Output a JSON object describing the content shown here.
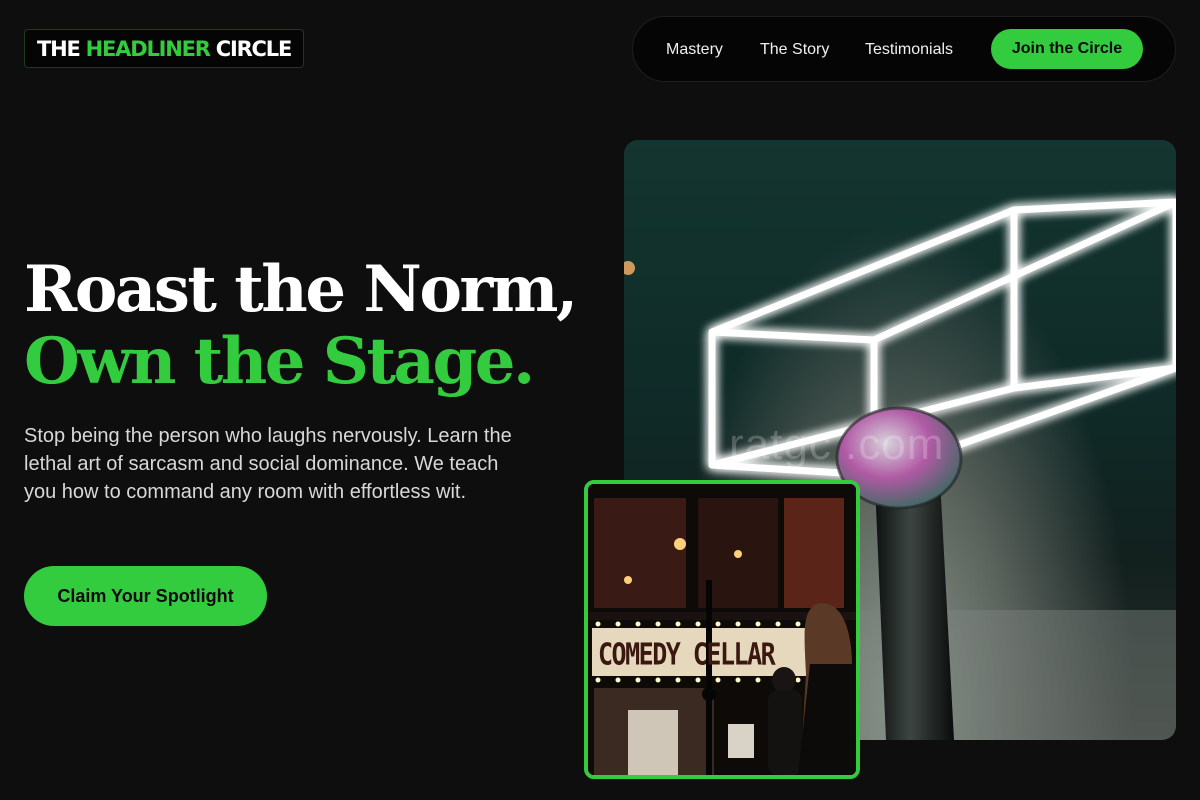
{
  "brand": {
    "logo_part1": "THE",
    "logo_part2": "HEADLINER",
    "logo_part3": "CIRCLE",
    "accent_color": "#34cc3f",
    "background_color": "#0e0e0e"
  },
  "nav": {
    "links": [
      {
        "label": "Mastery"
      },
      {
        "label": "The Story"
      },
      {
        "label": "Testimonials"
      }
    ],
    "cta_label": "Join the Circle"
  },
  "hero": {
    "headline_line1": "Roast the Norm,",
    "headline_line2": "Own the Stage.",
    "subtext": "Stop being the person who laughs nervously. Learn the lethal art of sarcasm and social dominance. We teach you how to command any room with effortless wit.",
    "cta_label": "Claim Your Spotlight"
  },
  "images": {
    "main_watermark": "ratgc     .com",
    "inset_sign": "COMEDY CELLAR"
  }
}
